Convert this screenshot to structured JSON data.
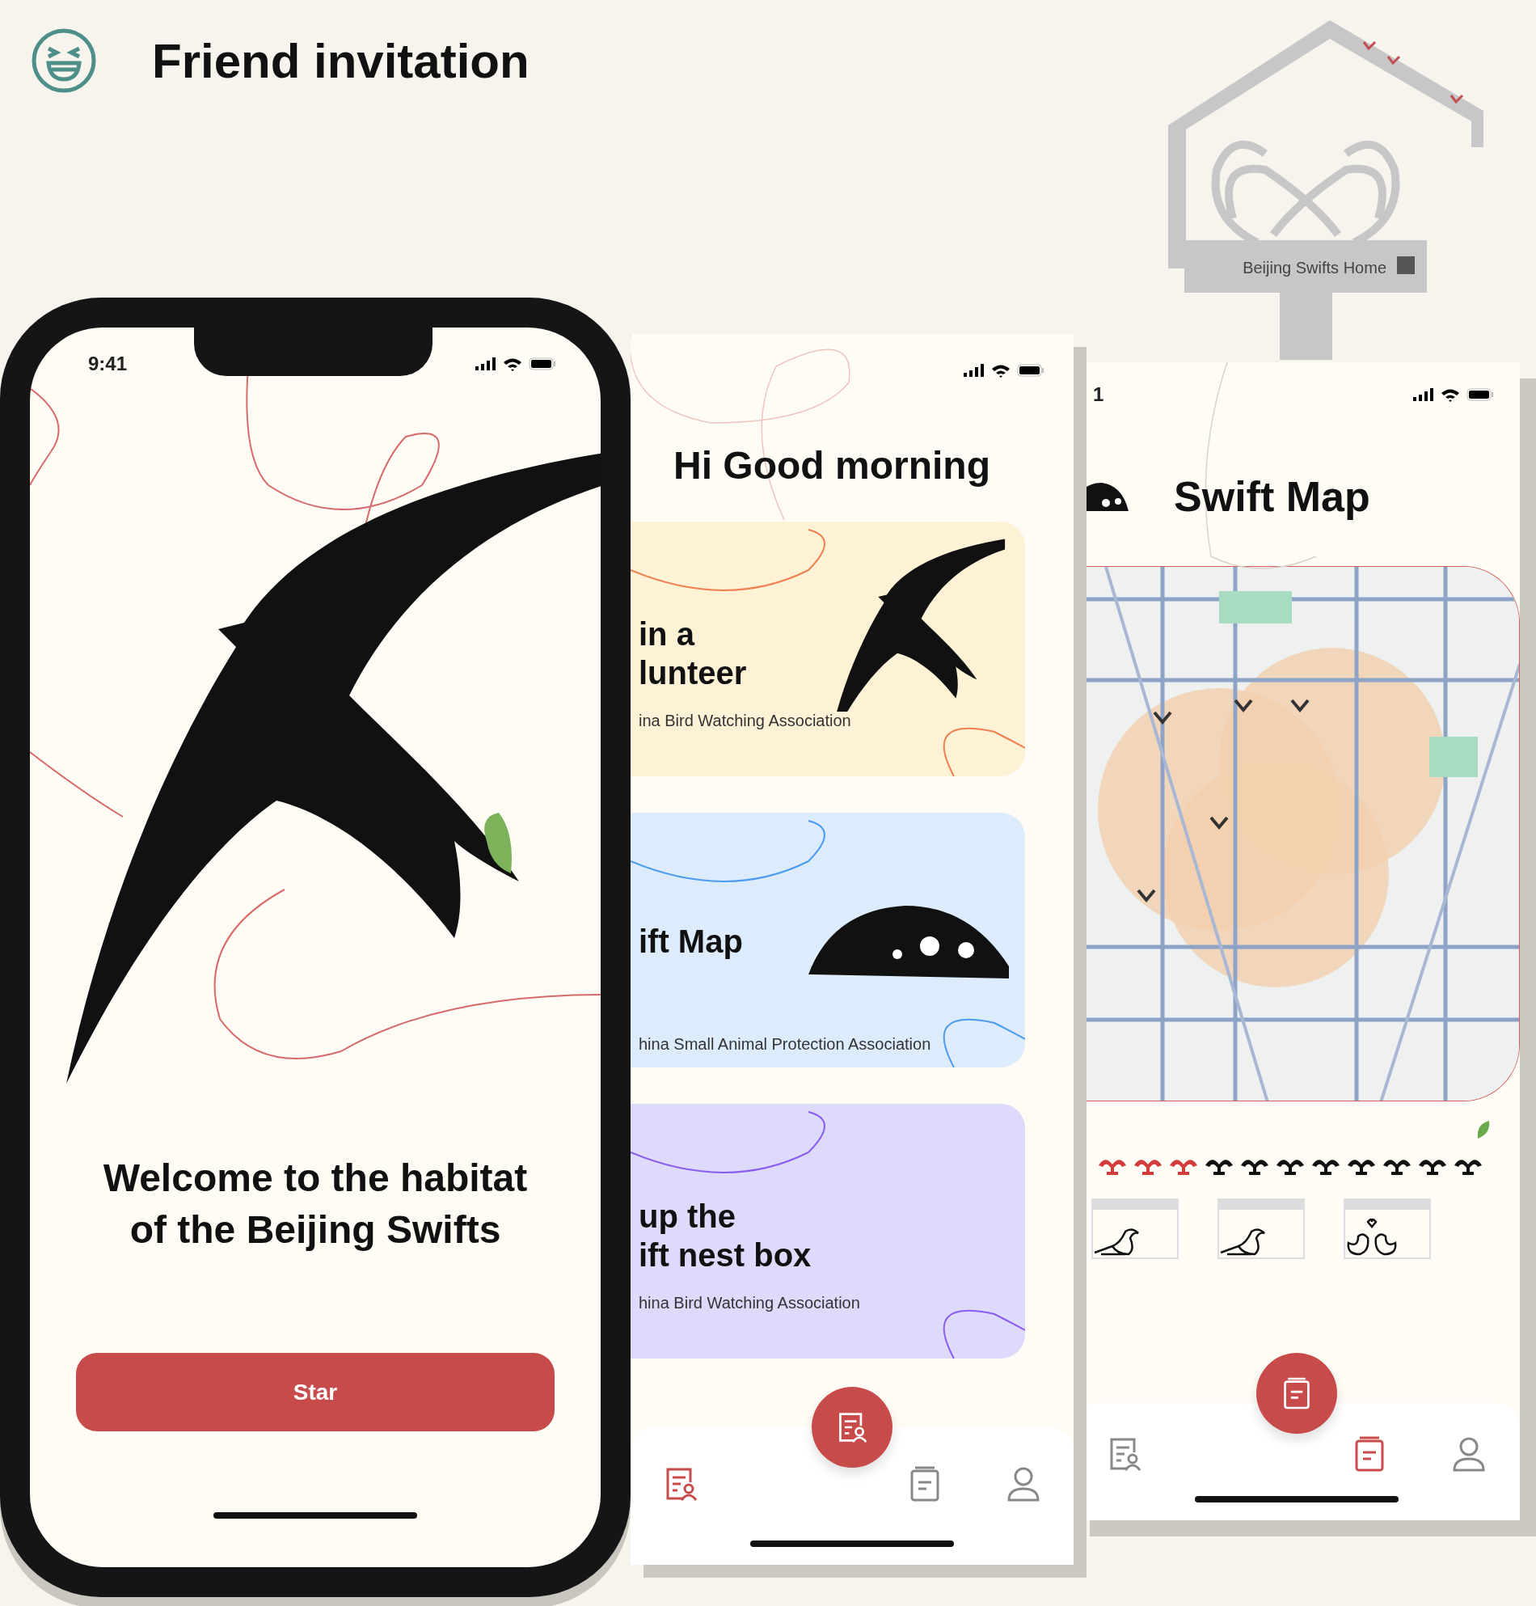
{
  "header": {
    "title": "Friend invitation"
  },
  "logo": {
    "sign": "Beijing Swifts Home"
  },
  "welcome_screen": {
    "time": "9:41",
    "heading_lines": [
      "Welcome to the habitat",
      "of the Beijing Swifts"
    ],
    "button": "Star"
  },
  "home_screen": {
    "greeting": "Hi Good morning",
    "cards": [
      {
        "kind": "swift",
        "color": "#fdf1d6",
        "title_lines": [
          "in a",
          "lunteer"
        ],
        "caption": "ina Bird Watching Association"
      },
      {
        "kind": "nest",
        "color": "#dcecfc",
        "title_lines": [
          "ift Map"
        ],
        "caption": "hina Small Animal Protection Association"
      },
      {
        "kind": "plain",
        "color": "#dddafc",
        "title_lines": [
          "up the",
          "ift nest box"
        ],
        "caption": "hina Bird Watching Association"
      }
    ],
    "nav": [
      {
        "kind": "tasks",
        "selected": true
      },
      {
        "kind": "notes",
        "selected": false
      },
      {
        "kind": "profile",
        "selected": false
      }
    ]
  },
  "map_screen": {
    "time": "1",
    "title": "Swift Map",
    "swift_marks": [
      {
        "color": "#d23c3c"
      },
      {
        "color": "#d23c3c"
      },
      {
        "color": "#d23c3c"
      },
      {
        "color": "#111111"
      },
      {
        "color": "#111111"
      },
      {
        "color": "#111111"
      },
      {
        "color": "#111111"
      },
      {
        "color": "#111111"
      },
      {
        "color": "#111111"
      },
      {
        "color": "#111111"
      },
      {
        "color": "#111111"
      }
    ],
    "nest_boxes": [
      {
        "kind": "single"
      },
      {
        "kind": "single"
      },
      {
        "kind": "pair"
      }
    ],
    "nav": [
      {
        "kind": "tasks",
        "selected": false
      },
      {
        "kind": "notes",
        "selected": true
      },
      {
        "kind": "profile",
        "selected": false
      }
    ]
  }
}
